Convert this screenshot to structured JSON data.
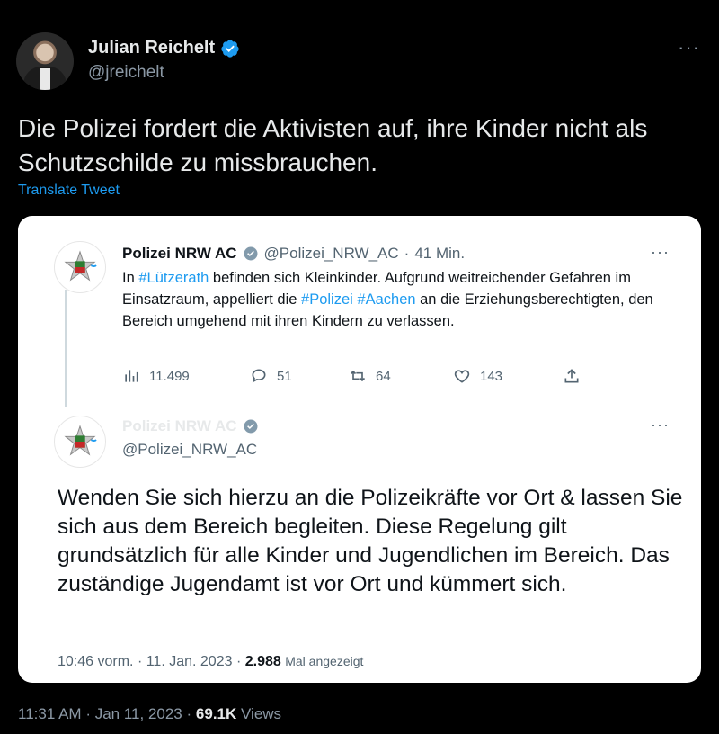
{
  "tweet": {
    "author_name": "Julian Reichelt",
    "author_handle": "@jreichelt",
    "more_icon": "more-horizontal-icon",
    "text": "Die Polizei fordert die Aktivisten auf, ihre Kinder nicht als Schutzschilde zu missbrauchen.",
    "translate_label": "Translate Tweet",
    "time": "11:31 AM",
    "separator": "·",
    "date": "Jan 11, 2023",
    "views_count": "69.1K",
    "views_label": "Views"
  },
  "quoted": {
    "author_name": "Polizei NRW AC",
    "author_handle": "@Polizei_NRW_AC",
    "age": "41 Min.",
    "separator": "·",
    "text_parts": {
      "hashtag1": "#Lützerath",
      "part1": " befinden sich Kleinkinder. Aufgrund weitreichender Gefahren im Einsatzraum, appelliert die ",
      "hashtag2": "#Polizei",
      "hashtag3": "#Aachen",
      "part2": " an die Erziehungsberechtigten, den Bereich umgehend mit ihren Kindern zu verlassen.",
      "prefix": "In "
    },
    "stats": {
      "views": "11.499",
      "replies": "51",
      "retweets": "64",
      "likes": "143"
    }
  },
  "reply": {
    "author_name": "Polizei NRW AC",
    "author_handle": "@Polizei_NRW_AC",
    "text": "Wenden Sie sich hierzu an die Polizeikräfte vor Ort & lassen Sie sich aus dem Bereich begleiten. Diese Regelung gilt grundsätzlich für alle Kinder und Jugendlichen im Bereich. Das zuständige Jugendamt ist vor Ort und kümmert sich.",
    "time": "10:46 vorm.",
    "separator": "·",
    "date": "11. Jan. 2023",
    "views_count": "2.988",
    "views_label": "Mal angezeigt"
  },
  "colors": {
    "background": "#000000",
    "accent": "#1d9bf0",
    "card": "#ffffff",
    "muted": "#8b98a5"
  }
}
